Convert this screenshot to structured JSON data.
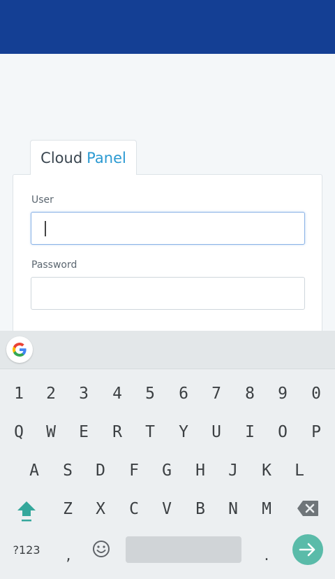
{
  "app": {
    "brand_primary": "Cloud",
    "brand_accent": "Panel"
  },
  "form": {
    "user_label": "User",
    "user_value": "",
    "password_label": "Password",
    "password_value": ""
  },
  "keyboard": {
    "number_row": [
      "1",
      "2",
      "3",
      "4",
      "5",
      "6",
      "7",
      "8",
      "9",
      "0"
    ],
    "row1": [
      "Q",
      "W",
      "E",
      "R",
      "T",
      "Y",
      "U",
      "I",
      "O",
      "P"
    ],
    "row2": [
      "A",
      "S",
      "D",
      "F",
      "G",
      "H",
      "J",
      "K",
      "L"
    ],
    "row3": [
      "Z",
      "X",
      "C",
      "V",
      "B",
      "N",
      "M"
    ],
    "symbols_key": "?123",
    "comma": ",",
    "period": ".",
    "icons": [
      "google-icon",
      "shift-icon",
      "backspace-icon",
      "emoji-icon",
      "enter-arrow-icon"
    ]
  },
  "colors": {
    "header": "#143f94",
    "accent": "#2b9ad2",
    "enter_key": "#5abba9",
    "shift": "#34a79b"
  }
}
